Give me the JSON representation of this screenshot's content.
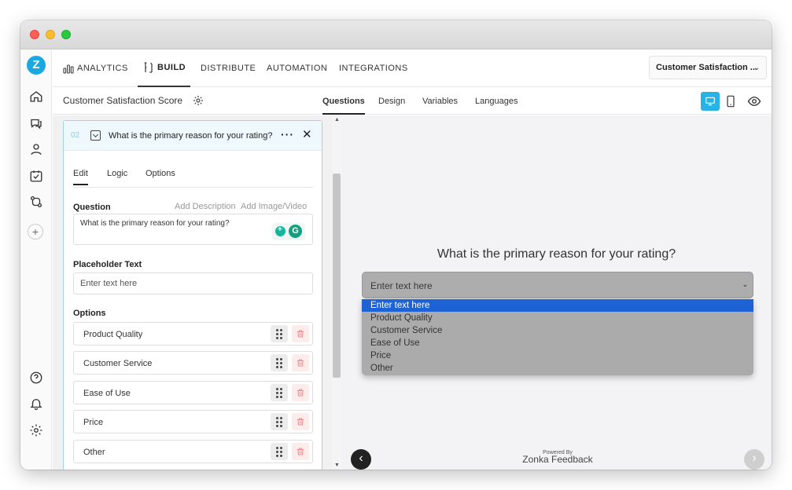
{
  "app": {
    "logo_letter": "Z",
    "accent_color": "#25b4e5"
  },
  "rail": {
    "items": [
      "home-icon",
      "chat-survey-icon",
      "user-icon",
      "calendar-check-icon",
      "workflow-icon",
      "plus-icon"
    ],
    "bottom_items": [
      "help-icon",
      "bell-icon",
      "settings-icon"
    ]
  },
  "topnav": {
    "analytics": "ANALYTICS",
    "build": "BUILD",
    "distribute": "DISTRIBUTE",
    "automation": "AUTOMATION",
    "integrations": "INTEGRATIONS",
    "survey_select": "Customer Satisfaction ..."
  },
  "subbar": {
    "survey_title": "Customer Satisfaction Score",
    "tabs": [
      "Questions",
      "Design",
      "Variables",
      "Languages"
    ],
    "active_tab": "Questions"
  },
  "editor": {
    "question_number": "02",
    "question_header": "What is the primary reason for your rating?",
    "tabs": [
      "Edit",
      "Logic",
      "Options"
    ],
    "active_tab": "Edit",
    "question_label": "Question",
    "add_description": "Add Description",
    "add_media": "Add Image/Video",
    "question_text": "What is the primary reason for your rating?",
    "placeholder_label": "Placeholder Text",
    "placeholder_value": "Enter text here",
    "options_label": "Options",
    "options": [
      "Product Quality",
      "Customer Service",
      "Ease of Use",
      "Price",
      "Other"
    ]
  },
  "preview": {
    "question": "What is the primary reason for your rating?",
    "select_placeholder": "Enter text here",
    "dropdown_options": [
      "Enter text here",
      "Product Quality",
      "Customer Service",
      "Ease of Use",
      "Price",
      "Other"
    ],
    "selected_option": "Enter text here",
    "powered_by": "Powered By",
    "brand": "Zonka Feedback"
  }
}
